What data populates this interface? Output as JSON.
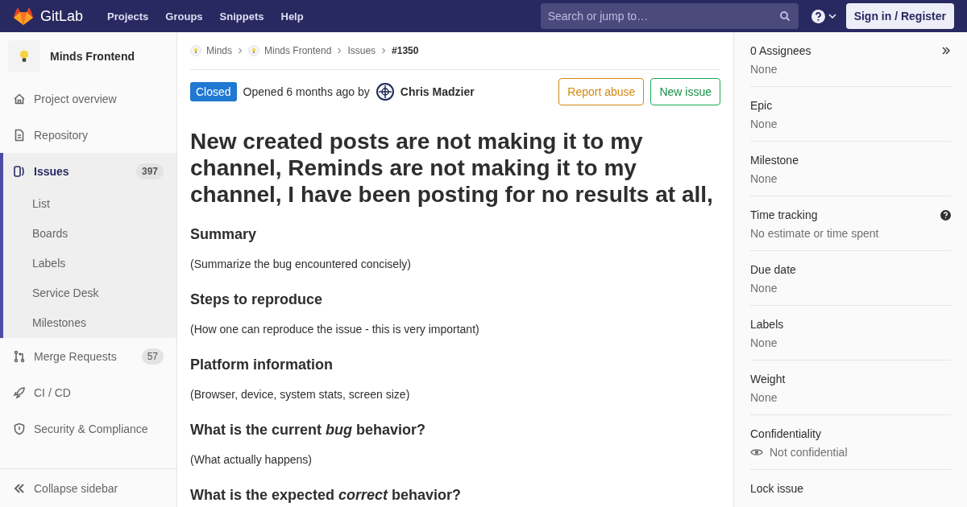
{
  "header": {
    "logo": "GitLab",
    "nav": [
      "Projects",
      "Groups",
      "Snippets",
      "Help"
    ],
    "search": {
      "placeholder": "Search or jump to…"
    },
    "sign_in": "Sign in / Register"
  },
  "sidebar": {
    "project": "Minds Frontend",
    "items": [
      {
        "label": "Project overview",
        "selected": false
      },
      {
        "label": "Repository",
        "selected": false
      },
      {
        "label": "Issues",
        "count": "397",
        "selected": true,
        "children": [
          {
            "label": "List"
          },
          {
            "label": "Boards"
          },
          {
            "label": "Labels"
          },
          {
            "label": "Service Desk"
          },
          {
            "label": "Milestones"
          }
        ]
      },
      {
        "label": "Merge Requests",
        "count": "57",
        "selected": false
      },
      {
        "label": "CI / CD",
        "selected": false
      },
      {
        "label": "Security & Compliance",
        "selected": false
      }
    ],
    "collapse": "Collapse sidebar"
  },
  "breadcrumbs": [
    {
      "label": "Minds",
      "avatar": true
    },
    {
      "label": "Minds Frontend",
      "avatar": true
    },
    {
      "label": "Issues",
      "avatar": false
    },
    {
      "label": "#1350",
      "avatar": false
    }
  ],
  "issue": {
    "status": "Closed",
    "meta": "Opened 6 months ago by",
    "author": "Chris Madzier",
    "buttons": [
      "Report abuse",
      "New issue"
    ],
    "title": "New created posts are not making it to my channel, Reminds are not making it to my channel, I have been posting for no results at all,",
    "sections": [
      {
        "heading": "Summary",
        "text": "(Summarize the bug encountered concisely)"
      },
      {
        "heading": "Steps to reproduce",
        "text": "(How one can reproduce the issue - this is very important)"
      },
      {
        "heading": "Platform information",
        "text": "(Browser, device, system stats, screen size)"
      },
      {
        "heading": "What is the current *bug* behavior?",
        "text": "(What actually happens)"
      },
      {
        "heading": "What is the expected *correct* behavior?"
      }
    ]
  },
  "details": [
    {
      "kind": "collapse",
      "label": "0 Assignees",
      "value": "None"
    },
    {
      "kind": "plain",
      "label": "Epic",
      "value": "None"
    },
    {
      "kind": "plain",
      "label": "Milestone",
      "value": "None"
    },
    {
      "kind": "help",
      "label": "Time tracking",
      "value": "No estimate or time spent"
    },
    {
      "kind": "plain",
      "label": "Due date",
      "value": "None"
    },
    {
      "kind": "plain",
      "label": "Labels",
      "value": "None"
    },
    {
      "kind": "plain",
      "label": "Weight",
      "value": "None"
    },
    {
      "kind": "confidential",
      "label": "Confidentiality",
      "value": "Not confidential"
    },
    {
      "kind": "plain",
      "label": "Lock issue"
    }
  ]
}
